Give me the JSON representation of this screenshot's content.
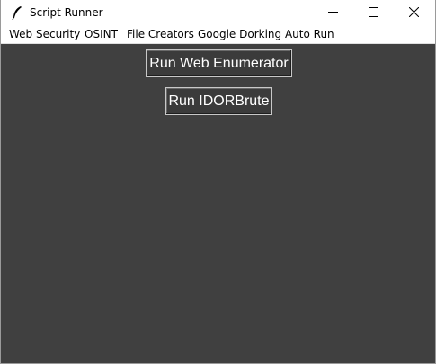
{
  "window": {
    "title": "Script Runner"
  },
  "menubar": {
    "items": [
      "Web Security",
      "OSINT",
      "File Creators",
      "Google Dorking Auto Run"
    ]
  },
  "main": {
    "buttons": [
      "Run Web Enumerator",
      "Run IDORBrute"
    ]
  },
  "colors": {
    "content_bg": "#404040",
    "button_bg": "#3b3b3b",
    "button_text": "#ffffff"
  }
}
